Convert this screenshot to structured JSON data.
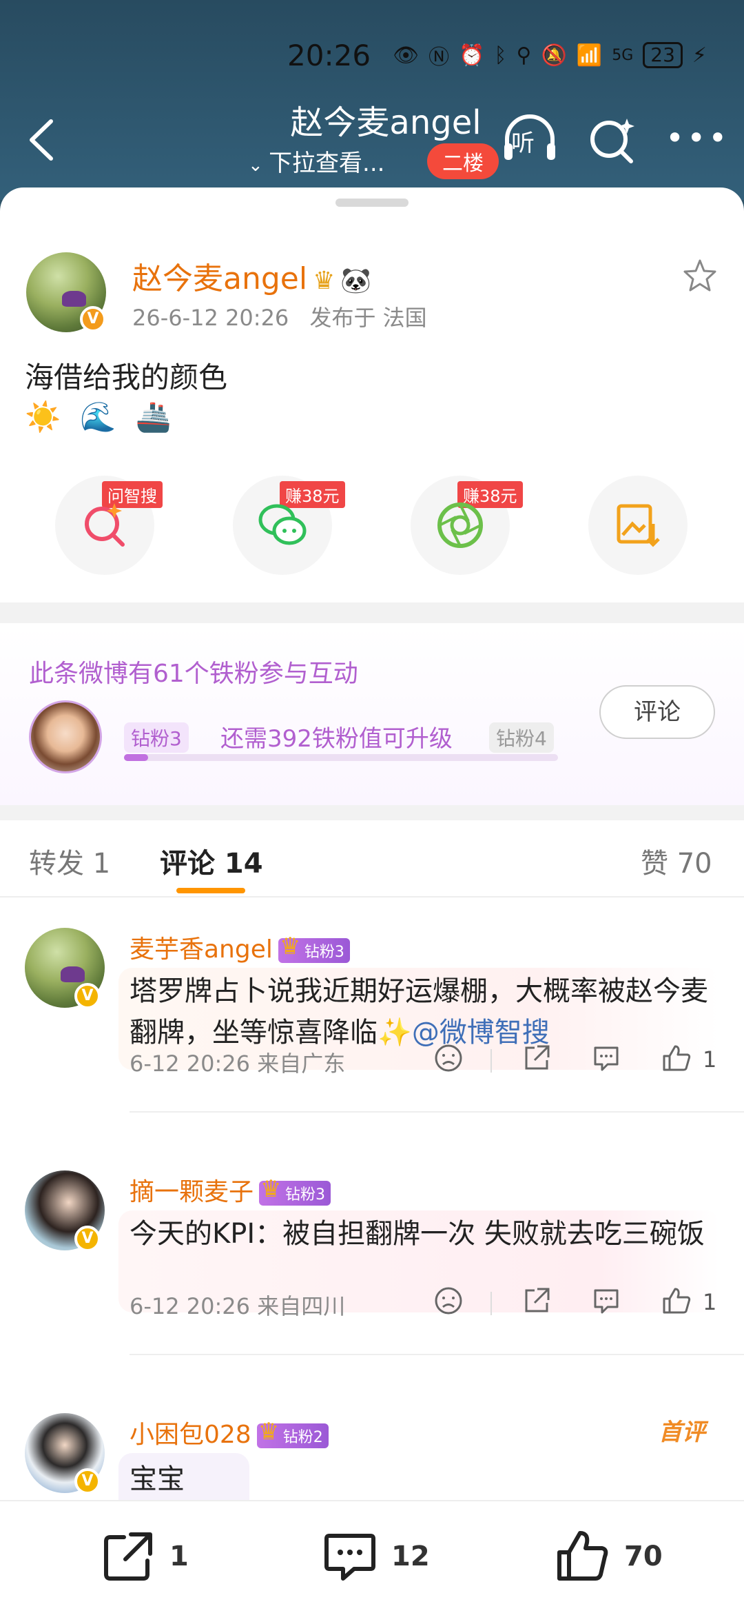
{
  "status_bar": {
    "time": "20:26",
    "network": "5G",
    "battery": "23"
  },
  "header": {
    "title": "赵今麦angel",
    "subtitle": "下拉查看...",
    "floor_badge": "二楼",
    "listen_label": "听"
  },
  "post": {
    "author": "赵今麦angel",
    "date": "26-6-12 20:26",
    "location": "发布于 法国",
    "text": "海借给我的颜色",
    "emoji": "☀️🌊🚢"
  },
  "share_tags": {
    "search": "问智搜",
    "wechat": "赚38元",
    "moments": "赚38元"
  },
  "fans": {
    "title": "此条微博有61个铁粉参与互动",
    "current_level": "钻粉3",
    "need_text": "还需392铁粉值可升级",
    "next_level": "钻粉4",
    "progress": 0.055,
    "comment_button": "评论"
  },
  "tabs": {
    "repost": "转发 1",
    "comments": "评论 14",
    "likes": "赞 70"
  },
  "comments": [
    {
      "user": "麦芋香angel",
      "badge": "钻粉3",
      "text": "塔罗牌占卜说我近期好运爆棚，大概率被赵今麦翻牌，坐等惊喜降临✨",
      "mention": "@微博智搜",
      "time": "6-12 20:26",
      "from": "来自广东",
      "likes": "1"
    },
    {
      "user": "摘一颗麦子",
      "badge": "钻粉3",
      "text": "今天的KPI：被自担翻牌一次 失败就去吃三碗饭",
      "time": "6-12 20:26",
      "from": "来自四川",
      "likes": "1"
    },
    {
      "user": "小困包028",
      "badge": "钻粉2",
      "text": "宝宝",
      "first_tag": "首评"
    }
  ],
  "bottom_bar": {
    "reposts": "1",
    "comments": "12",
    "likes": "70"
  }
}
